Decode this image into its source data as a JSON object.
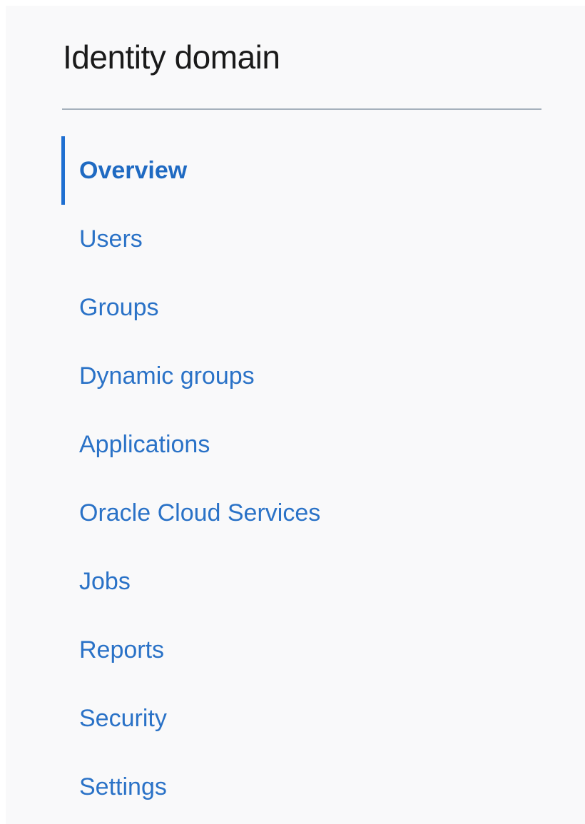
{
  "sidebar": {
    "title": "Identity domain",
    "active_item": "Overview",
    "accent_color": "#1f6fd1",
    "link_color": "#2a72c7",
    "items": [
      {
        "label": "Overview"
      },
      {
        "label": "Users"
      },
      {
        "label": "Groups"
      },
      {
        "label": "Dynamic groups"
      },
      {
        "label": "Applications"
      },
      {
        "label": "Oracle Cloud Services"
      },
      {
        "label": "Jobs"
      },
      {
        "label": "Reports"
      },
      {
        "label": "Security"
      },
      {
        "label": "Settings"
      }
    ]
  }
}
